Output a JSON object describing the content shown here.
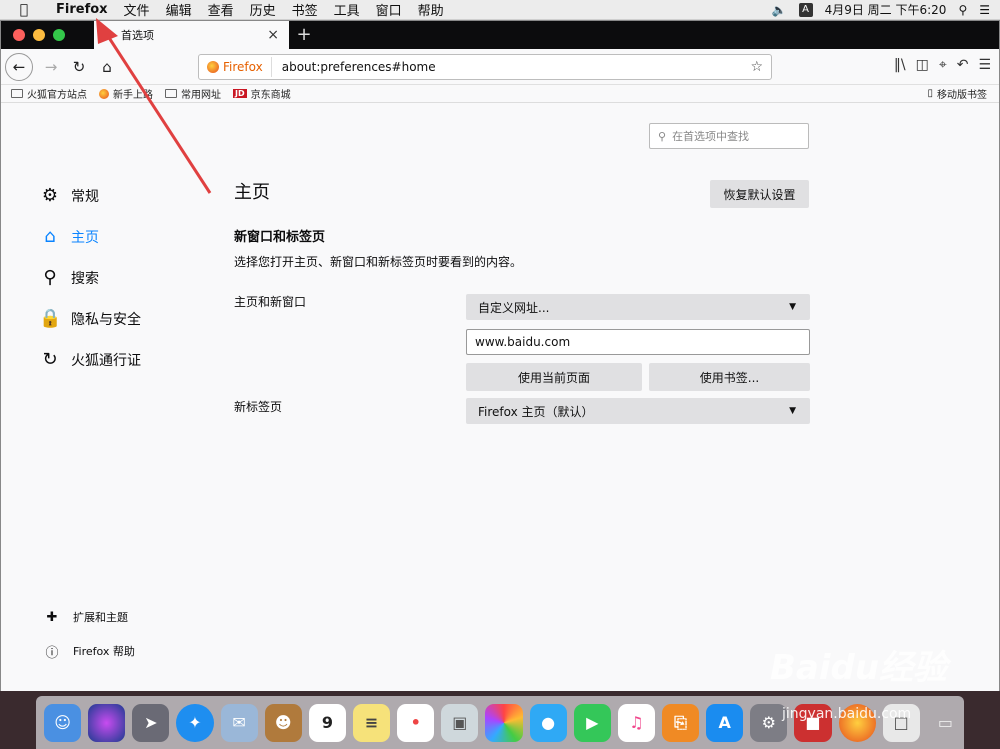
{
  "menubar": {
    "app": "Firefox",
    "items": [
      "文件",
      "编辑",
      "查看",
      "历史",
      "书签",
      "工具",
      "窗口",
      "帮助"
    ],
    "ime": "A",
    "datetime": "4月9日 周二 下午6:20"
  },
  "tab": {
    "title": "首选项"
  },
  "navbar": {
    "identity_label": "Firefox",
    "url": "about:preferences#home"
  },
  "bookmarks": [
    {
      "label": "火狐官方站点"
    },
    {
      "label": "新手上路"
    },
    {
      "label": "常用网址"
    },
    {
      "label": "京东商城",
      "badge": "JD"
    }
  ],
  "mobile_bookmarks": "移动版书签",
  "search": {
    "placeholder": "在首选项中查找"
  },
  "sidebar": {
    "items": [
      {
        "label": "常规",
        "icon": "gear-icon"
      },
      {
        "label": "主页",
        "icon": "home-icon",
        "active": true
      },
      {
        "label": "搜索",
        "icon": "search-icon"
      },
      {
        "label": "隐私与安全",
        "icon": "lock-icon"
      },
      {
        "label": "火狐通行证",
        "icon": "sync-icon"
      }
    ],
    "bottom": [
      {
        "label": "扩展和主题",
        "icon": "puzzle-icon"
      },
      {
        "label": "Firefox 帮助",
        "icon": "help-icon"
      }
    ]
  },
  "main": {
    "title": "主页",
    "restore_button": "恢复默认设置",
    "section_title": "新窗口和标签页",
    "section_desc": "选择您打开主页、新窗口和新标签页时要看到的内容。",
    "homepage_label": "主页和新窗口",
    "homepage_select": "自定义网址...",
    "homepage_url": "www.baidu.com",
    "use_current_button": "使用当前页面",
    "use_bookmark_button": "使用书签...",
    "newtab_label": "新标签页",
    "newtab_select": "Firefox 主页（默认）"
  },
  "watermark": {
    "main": "Baidu经验",
    "sub": "jingyan.baidu.com"
  },
  "colors": {
    "accent": "#0a84ff",
    "arrow": "#e04040"
  }
}
